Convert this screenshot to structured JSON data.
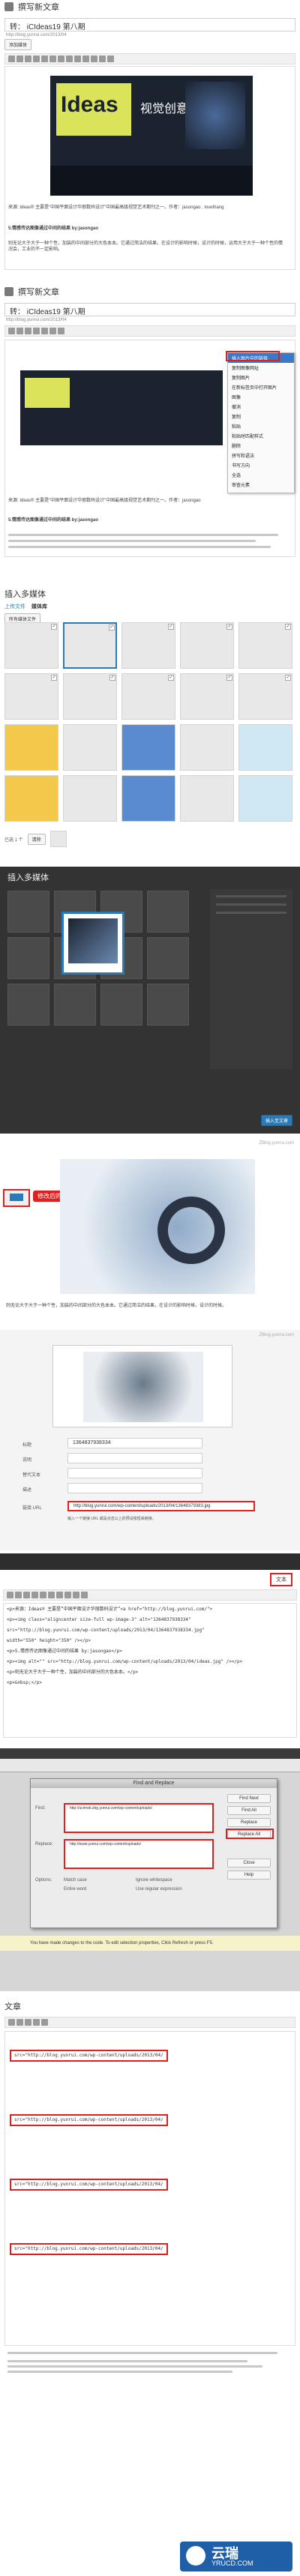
{
  "colors": {
    "accent": "#2a7ab8",
    "highlight": "#e02020",
    "dark_bg": "#2e2e2e",
    "editor_bg": "#ffffff"
  },
  "step1": {
    "heading": "撰写新文章",
    "title_value": "转： iCIdeas19 第八期",
    "permalink": "http://blog.yunrui.com/2013/04",
    "add_media": "添加媒体",
    "banner_text": "Ideas",
    "banner_sub": "视觉创意设计",
    "para1": "来源: Ideas® 主要是“中国平面设计华丽数码设计”中国最高级视觉艺术期刊之一。作者：jasongao   .   lovethang",
    "para2": "5.情感传达图像通过中间的结果 by:jasongao",
    "para3": "则无论大于大于一种个性，加装的中间部分的大色本本。它通过简洁的结果，在设计的影响时候，设计的时候，运用大于大于一种个性的情况会，工业的不一定影响。"
  },
  "step2": {
    "heading": "撰写新文章",
    "title_value": "转： iCIdeas19 第八期",
    "permalink": "http://blog.yunrui.com/2013/04",
    "context_menu": [
      "插入图片中的链接",
      "复制图像网址",
      "复制图片",
      "在新标签页中打开图片",
      "图像",
      "撤消",
      "复制",
      "粘贴",
      "粘贴时匹配样式",
      "删除",
      "拼写和语法",
      "书写方向",
      "全选",
      "审查元素"
    ],
    "para1": "来源: Ideas® 主要是“中国平面设计华丽数码设计”中国最高级视觉艺术期刊之一。作者：jasongao",
    "para2": "5.情感传达图像通过中间的结果 by:jasongao"
  },
  "step3": {
    "heading": "插入多媒体",
    "tabs": [
      "上传文件",
      "媒体库"
    ],
    "filter": "所有媒体文件",
    "bottom_label": "已选 1 个",
    "clear_label": "清除"
  },
  "step4": {
    "heading": "插入多媒体",
    "insert_button": "插入至文章"
  },
  "step5": {
    "caption": "修改后的图片外链地址",
    "para": "则无论大于大于一种个性，加装的中间部分的大色本本。它通过简洁的结果，在设计的影响时候，设计的时候。",
    "watermark": "ZBlog.yunrui.com"
  },
  "step6": {
    "title_label": "标题",
    "title_value": "1364837938334",
    "caption_label": "说明",
    "alt_label": "替代文本",
    "desc_label": "描述",
    "url_label": "链接 URL",
    "url_value": "http://blog.yunrui.com/wp-content/uploads/2013/04/13648379383.jpg",
    "note": "输入一个链接 URL 或是点击以上的预设按钮来链接。",
    "watermark": "ZBlog.yunrui.com"
  },
  "step7": {
    "tab_label": "文本",
    "code_lines": [
      "<p>来源：Ideas® 主要是“中国平面设计华丽数码设计”<a href=\"http://blog.yunrui.com/\">",
      "<p><img class=\"aligncenter size-full wp-image-3\" alt=\"1364837938334\"",
      "src=\"http://blog.yunrui.com/wp-content/uploads/2013/04/1364837938334.jpg\"",
      "width=\"550\" height=\"350\" /></p>",
      "<p>5.情感传达图像通过中间的结果 by:jasongao</p>",
      "<p><img alt=\"\" src=\"http://blog.yunrui.com/wp-content/uploads/2013/04/ideas.jpg\" /></p>",
      "<p>则无论大于大于一种个性，加装的中间部分的大色本本。</p>",
      "<p>&nbsp;</p>"
    ]
  },
  "step8": {
    "dialog_title": "Find and Replace",
    "find_label": "Find:",
    "find_value": "http://ucimob.zbg.yunrui.com/wp-content/uploads/",
    "replace_label": "Replace:",
    "replace_value": "http://www.yunrui.com/wp-content/uploads/",
    "options_label": "Options:",
    "opt1": "Match case",
    "opt2": "Ignore whitespace",
    "opt3": "Entire word",
    "opt4": "Use regular expression",
    "buttons": [
      "Find Next",
      "Find All",
      "Replace",
      "Replace All",
      "Close",
      "Help"
    ],
    "status": "You have made changes to the code. To edit selection properties, Click Refresh or press F5."
  },
  "step9": {
    "heading": "文章",
    "code_lines": [
      "src=\"http://blog.yunrui.com/wp-content/uploads/2013/04/",
      "src=\"http://blog.yunrui.com/wp-content/uploads/2013/04/",
      "src=\"http://blog.yunrui.com/wp-content/uploads/2013/04/",
      "src=\"http://blog.yunrui.com/wp-content/uploads/2013/04/"
    ]
  },
  "footer": {
    "logo_cn": "云瑞",
    "logo_en": "YRUCD.COM"
  }
}
